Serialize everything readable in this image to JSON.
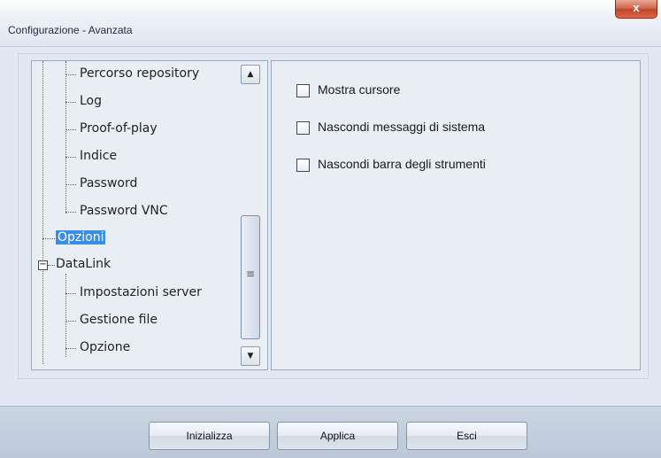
{
  "window": {
    "title": "Configurazione - Avanzata",
    "close_glyph": "x"
  },
  "tree": {
    "items": [
      {
        "label": "Percorso repository"
      },
      {
        "label": "Log"
      },
      {
        "label": "Proof-of-play"
      },
      {
        "label": "Indice"
      },
      {
        "label": "Password"
      },
      {
        "label": "Password VNC"
      },
      {
        "label": "Opzioni",
        "selected": true
      },
      {
        "label": "DataLink",
        "expanded": true
      },
      {
        "label": "Impostazioni server"
      },
      {
        "label": "Gestione file"
      },
      {
        "label": "Opzione"
      }
    ],
    "expand_glyph": "−"
  },
  "scrollbar": {
    "up_glyph": "▲",
    "down_glyph": "▼",
    "grip_glyph": "≡"
  },
  "options": [
    {
      "label": "Mostra cursore",
      "checked": false
    },
    {
      "label": "Nascondi messaggi di sistema",
      "checked": false
    },
    {
      "label": "Nascondi barra degli strumenti",
      "checked": false
    }
  ],
  "buttons": {
    "reset": "Inizializza",
    "apply": "Applica",
    "exit": "Esci"
  },
  "colors": {
    "selection": "#3a8ee6",
    "close": "#c2452a",
    "panel": "#e9eef5"
  }
}
